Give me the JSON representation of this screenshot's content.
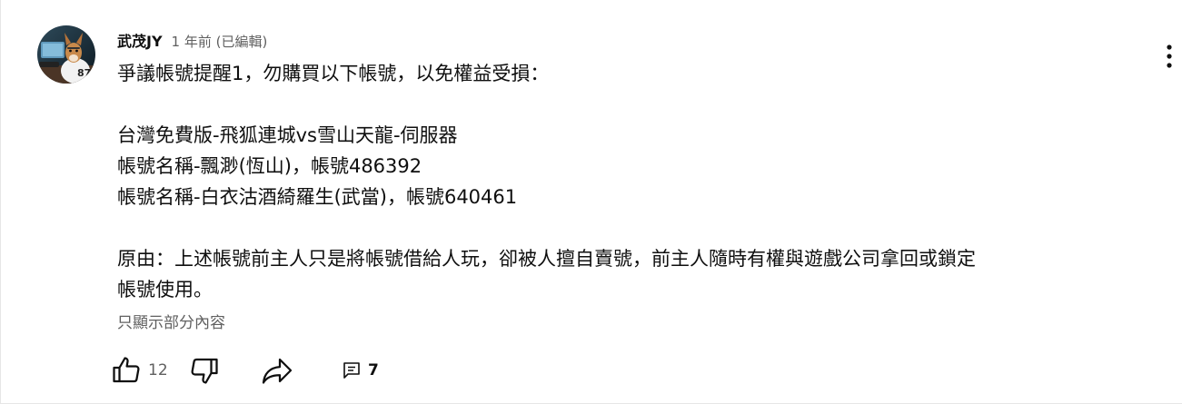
{
  "comment": {
    "author": "武茂JY",
    "timestamp": "1 年前 (已編輯)",
    "lines": [
      "爭議帳號提醒1，勿購買以下帳號，以免權益受損：",
      "",
      "台灣免費版-飛狐連城vs雪山天龍-伺服器",
      "帳號名稱-飄渺(恆山)，帳號486392",
      "帳號名稱-白衣沽酒綺羅生(武當)，帳號640461",
      "",
      "原由：上述帳號前主人只是將帳號借給人玩，卻被人擅自賣號，前主人隨時有權與遊戲公司拿回或鎖定",
      "帳號使用。"
    ],
    "show_less_label": "只顯示部分內容",
    "like_count": "12",
    "reply_count": "7"
  },
  "icons": {
    "more": "more-vertical-icon",
    "like": "thumb-up-icon",
    "dislike": "thumb-down-icon",
    "share": "share-icon",
    "reply": "comment-icon"
  },
  "colors": {
    "primary_text": "#0f0f0f",
    "secondary_text": "#606060"
  }
}
